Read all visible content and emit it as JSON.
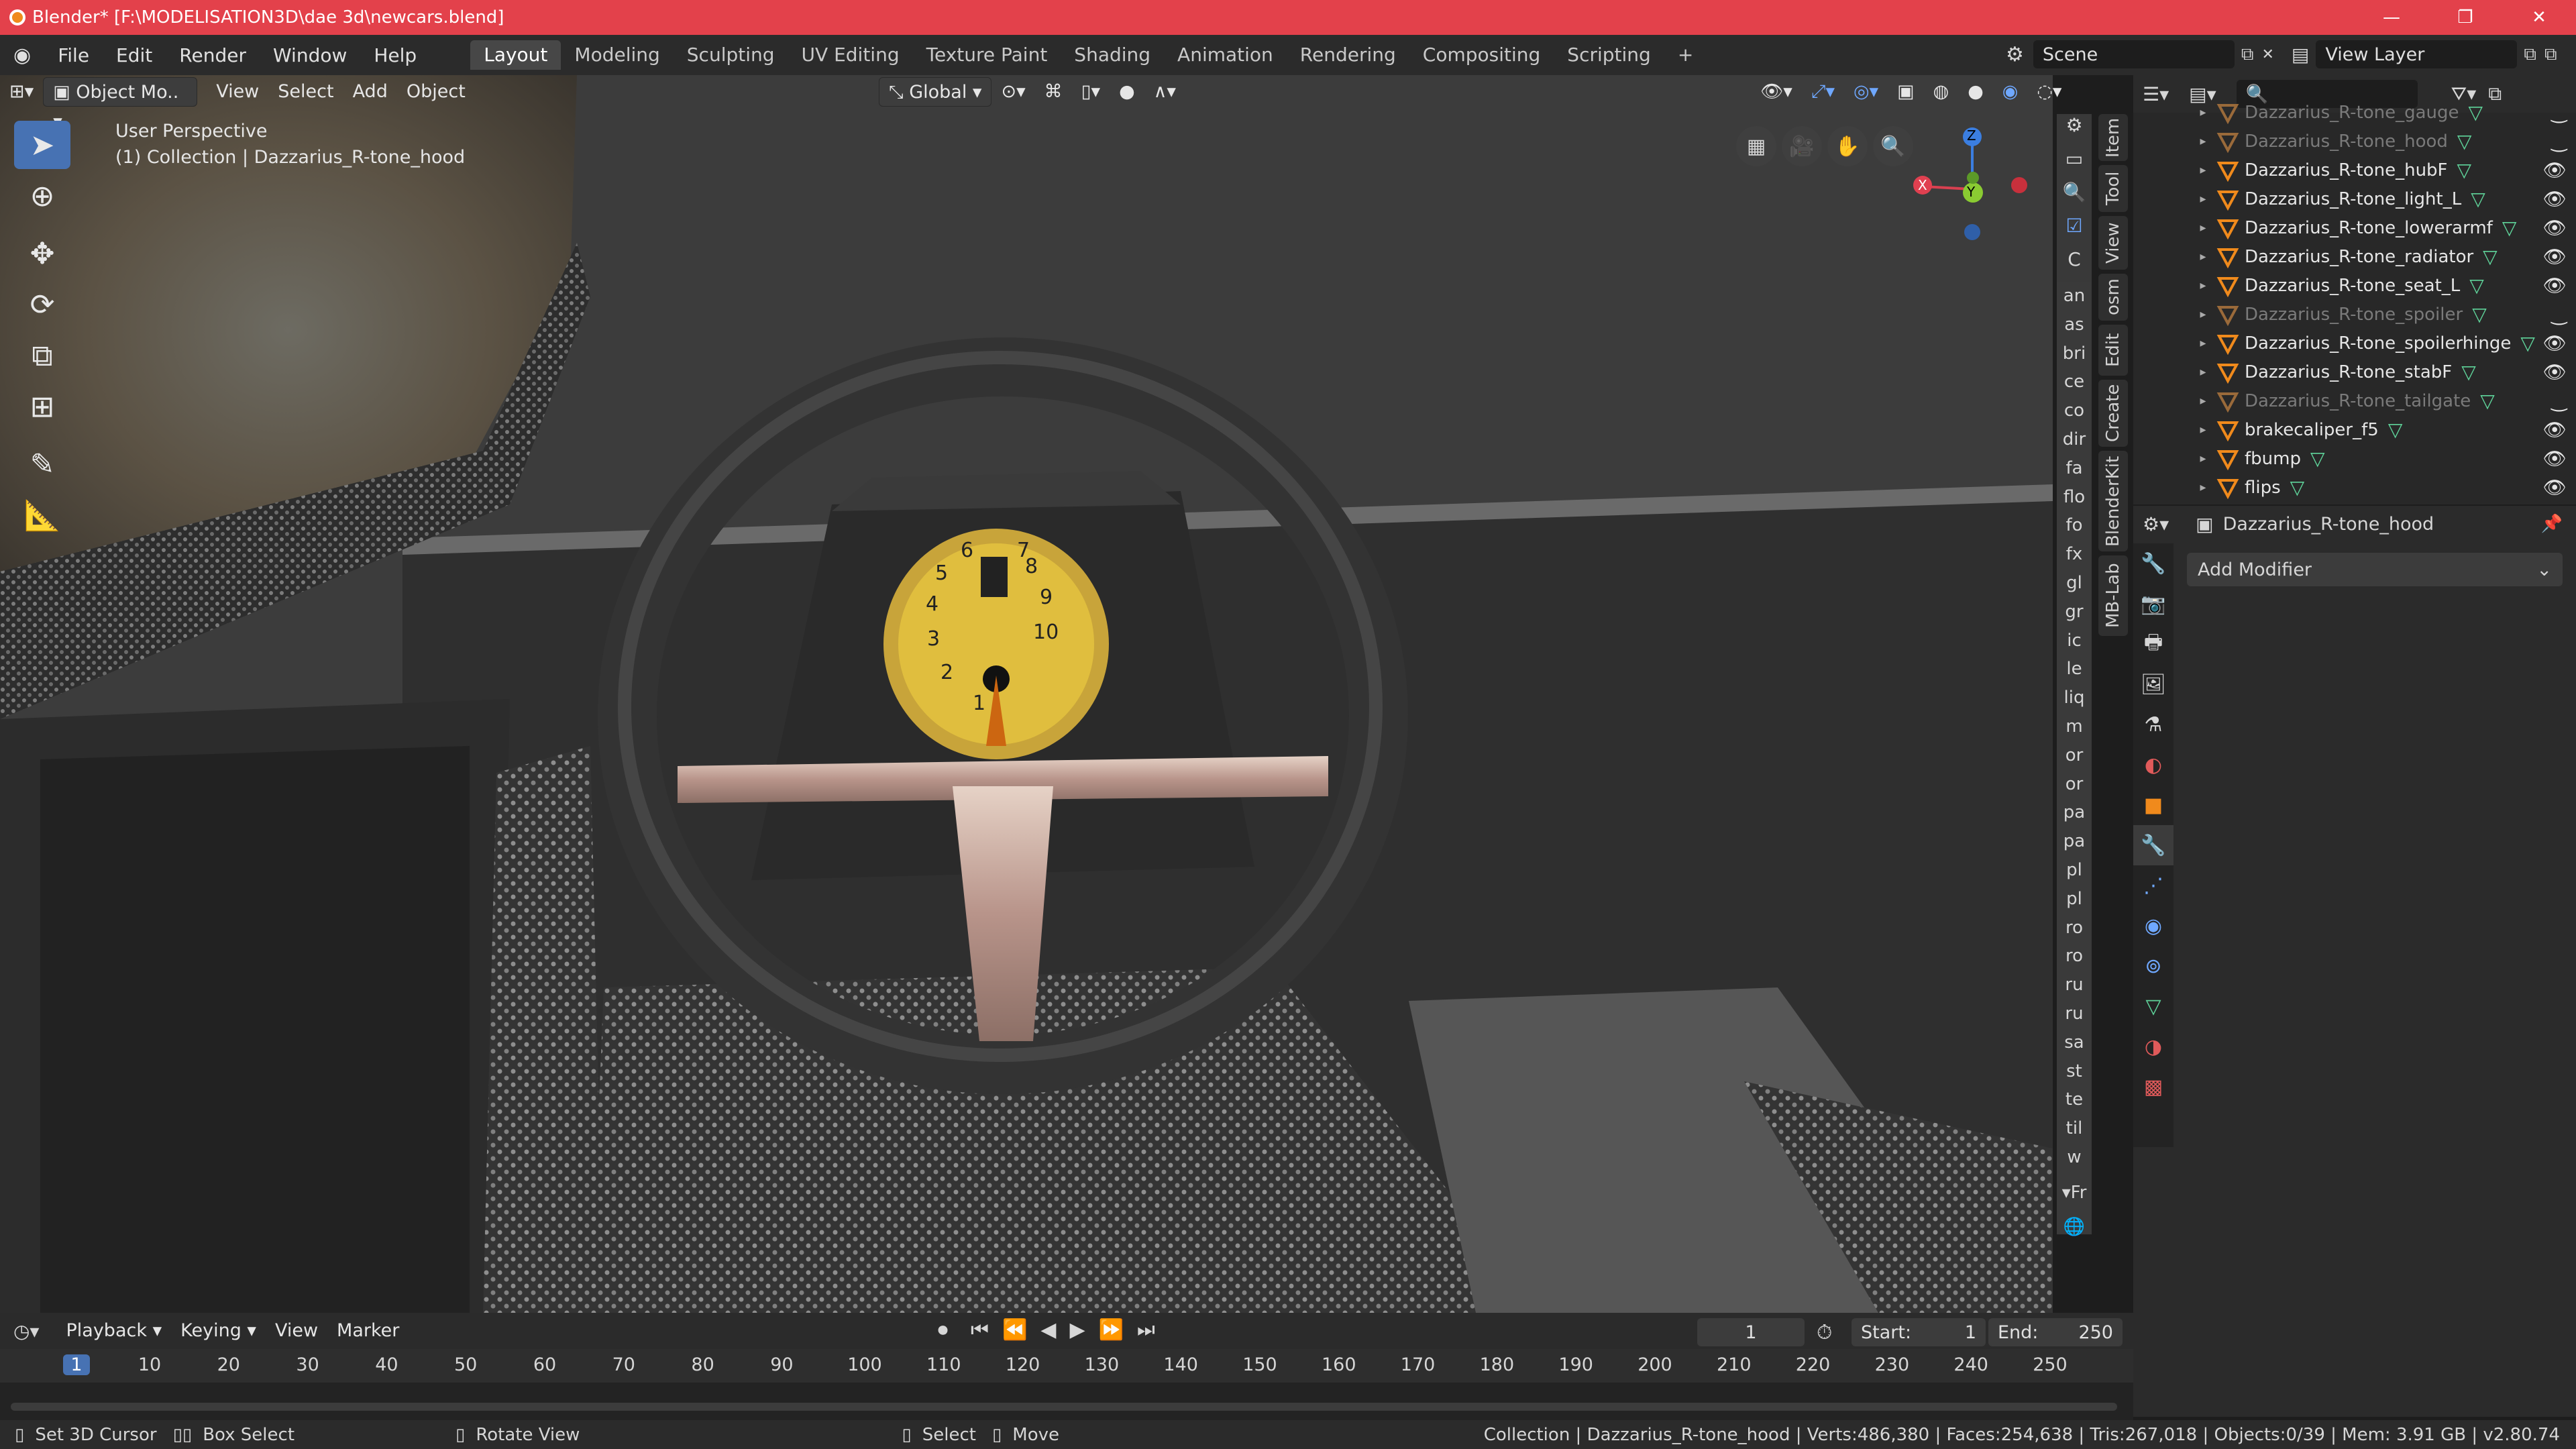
{
  "window": {
    "title": "Blender* [F:\\MODELISATION3D\\dae 3d\\newcars.blend]",
    "min": "—",
    "max": "❐",
    "close": "✕"
  },
  "menu": [
    "File",
    "Edit",
    "Render",
    "Window",
    "Help"
  ],
  "workspaces": [
    "Layout",
    "Modeling",
    "Sculpting",
    "UV Editing",
    "Texture Paint",
    "Shading",
    "Animation",
    "Rendering",
    "Compositing",
    "Scripting",
    "+"
  ],
  "scene": {
    "label": "Scene",
    "view_layer": "View Layer"
  },
  "viewport_header": {
    "mode": "Object Mo..",
    "menus": [
      "View",
      "Select",
      "Add",
      "Object"
    ],
    "orientation": "Global"
  },
  "viewport": {
    "perspective": "User Perspective",
    "collection_info": "(1) Collection | Dazzarius_R-tone_hood",
    "gizmo": {
      "z": "Z",
      "y": "Y",
      "x": "X"
    }
  },
  "sidebar_tabs": [
    "Item",
    "Tool",
    "View",
    "osm",
    "Edit",
    "Create",
    "BlenderKit",
    "MB-Lab"
  ],
  "addon_letter": "C",
  "addon_items": [
    "an",
    "as",
    "bri",
    "ce",
    "co",
    "dir",
    "fa",
    "flo",
    "fo",
    "fx",
    "gl",
    "gr",
    "ic",
    "le",
    "liq",
    "m",
    "or",
    "or",
    "pa",
    "pa",
    "pl",
    "pl",
    "ro",
    "ro",
    "ru",
    "ru",
    "sa",
    "st",
    "te",
    "til",
    "w"
  ],
  "addon_footer": "Fr",
  "outliner": {
    "rows": [
      {
        "name": "Dazzarius_R-tone_gauge",
        "dim": true
      },
      {
        "name": "Dazzarius_R-tone_hood",
        "dim": true
      },
      {
        "name": "Dazzarius_R-tone_hubF",
        "dim": false
      },
      {
        "name": "Dazzarius_R-tone_light_L",
        "dim": false
      },
      {
        "name": "Dazzarius_R-tone_lowerarmf",
        "dim": false
      },
      {
        "name": "Dazzarius_R-tone_radiator",
        "dim": false
      },
      {
        "name": "Dazzarius_R-tone_seat_L",
        "dim": false
      },
      {
        "name": "Dazzarius_R-tone_spoiler",
        "dim": true
      },
      {
        "name": "Dazzarius_R-tone_spoilerhinge",
        "dim": false
      },
      {
        "name": "Dazzarius_R-tone_stabF",
        "dim": false
      },
      {
        "name": "Dazzarius_R-tone_tailgate",
        "dim": true
      },
      {
        "name": "brakecaliper_f5",
        "dim": false
      },
      {
        "name": "fbump",
        "dim": false
      },
      {
        "name": "flips",
        "dim": false
      }
    ]
  },
  "properties": {
    "object_name": "Dazzarius_R-tone_hood",
    "add_modifier": "Add Modifier"
  },
  "timeline": {
    "menus": [
      "Playback",
      "Keying",
      "View",
      "Marker"
    ],
    "current_frame": "1",
    "start_label": "Start:",
    "start": "1",
    "end_label": "End:",
    "end": "250",
    "ticks": [
      "1",
      "10",
      "20",
      "30",
      "40",
      "50",
      "60",
      "70",
      "80",
      "90",
      "100",
      "110",
      "120",
      "130",
      "140",
      "150",
      "160",
      "170",
      "180",
      "190",
      "200",
      "210",
      "220",
      "230",
      "240",
      "250"
    ]
  },
  "statusbar": {
    "hints": [
      "Set 3D Cursor",
      "Box Select",
      "Rotate View",
      "Select",
      "Move"
    ],
    "info": "Collection | Dazzarius_R-tone_hood | Verts:486,380 | Faces:254,638 | Tris:267,018 | Objects:0/39 | Mem: 3.91 GB | v2.80.74"
  },
  "gauge_numbers": [
    "1",
    "2",
    "3",
    "4",
    "5",
    "6",
    "7",
    "8",
    "9",
    "10"
  ]
}
